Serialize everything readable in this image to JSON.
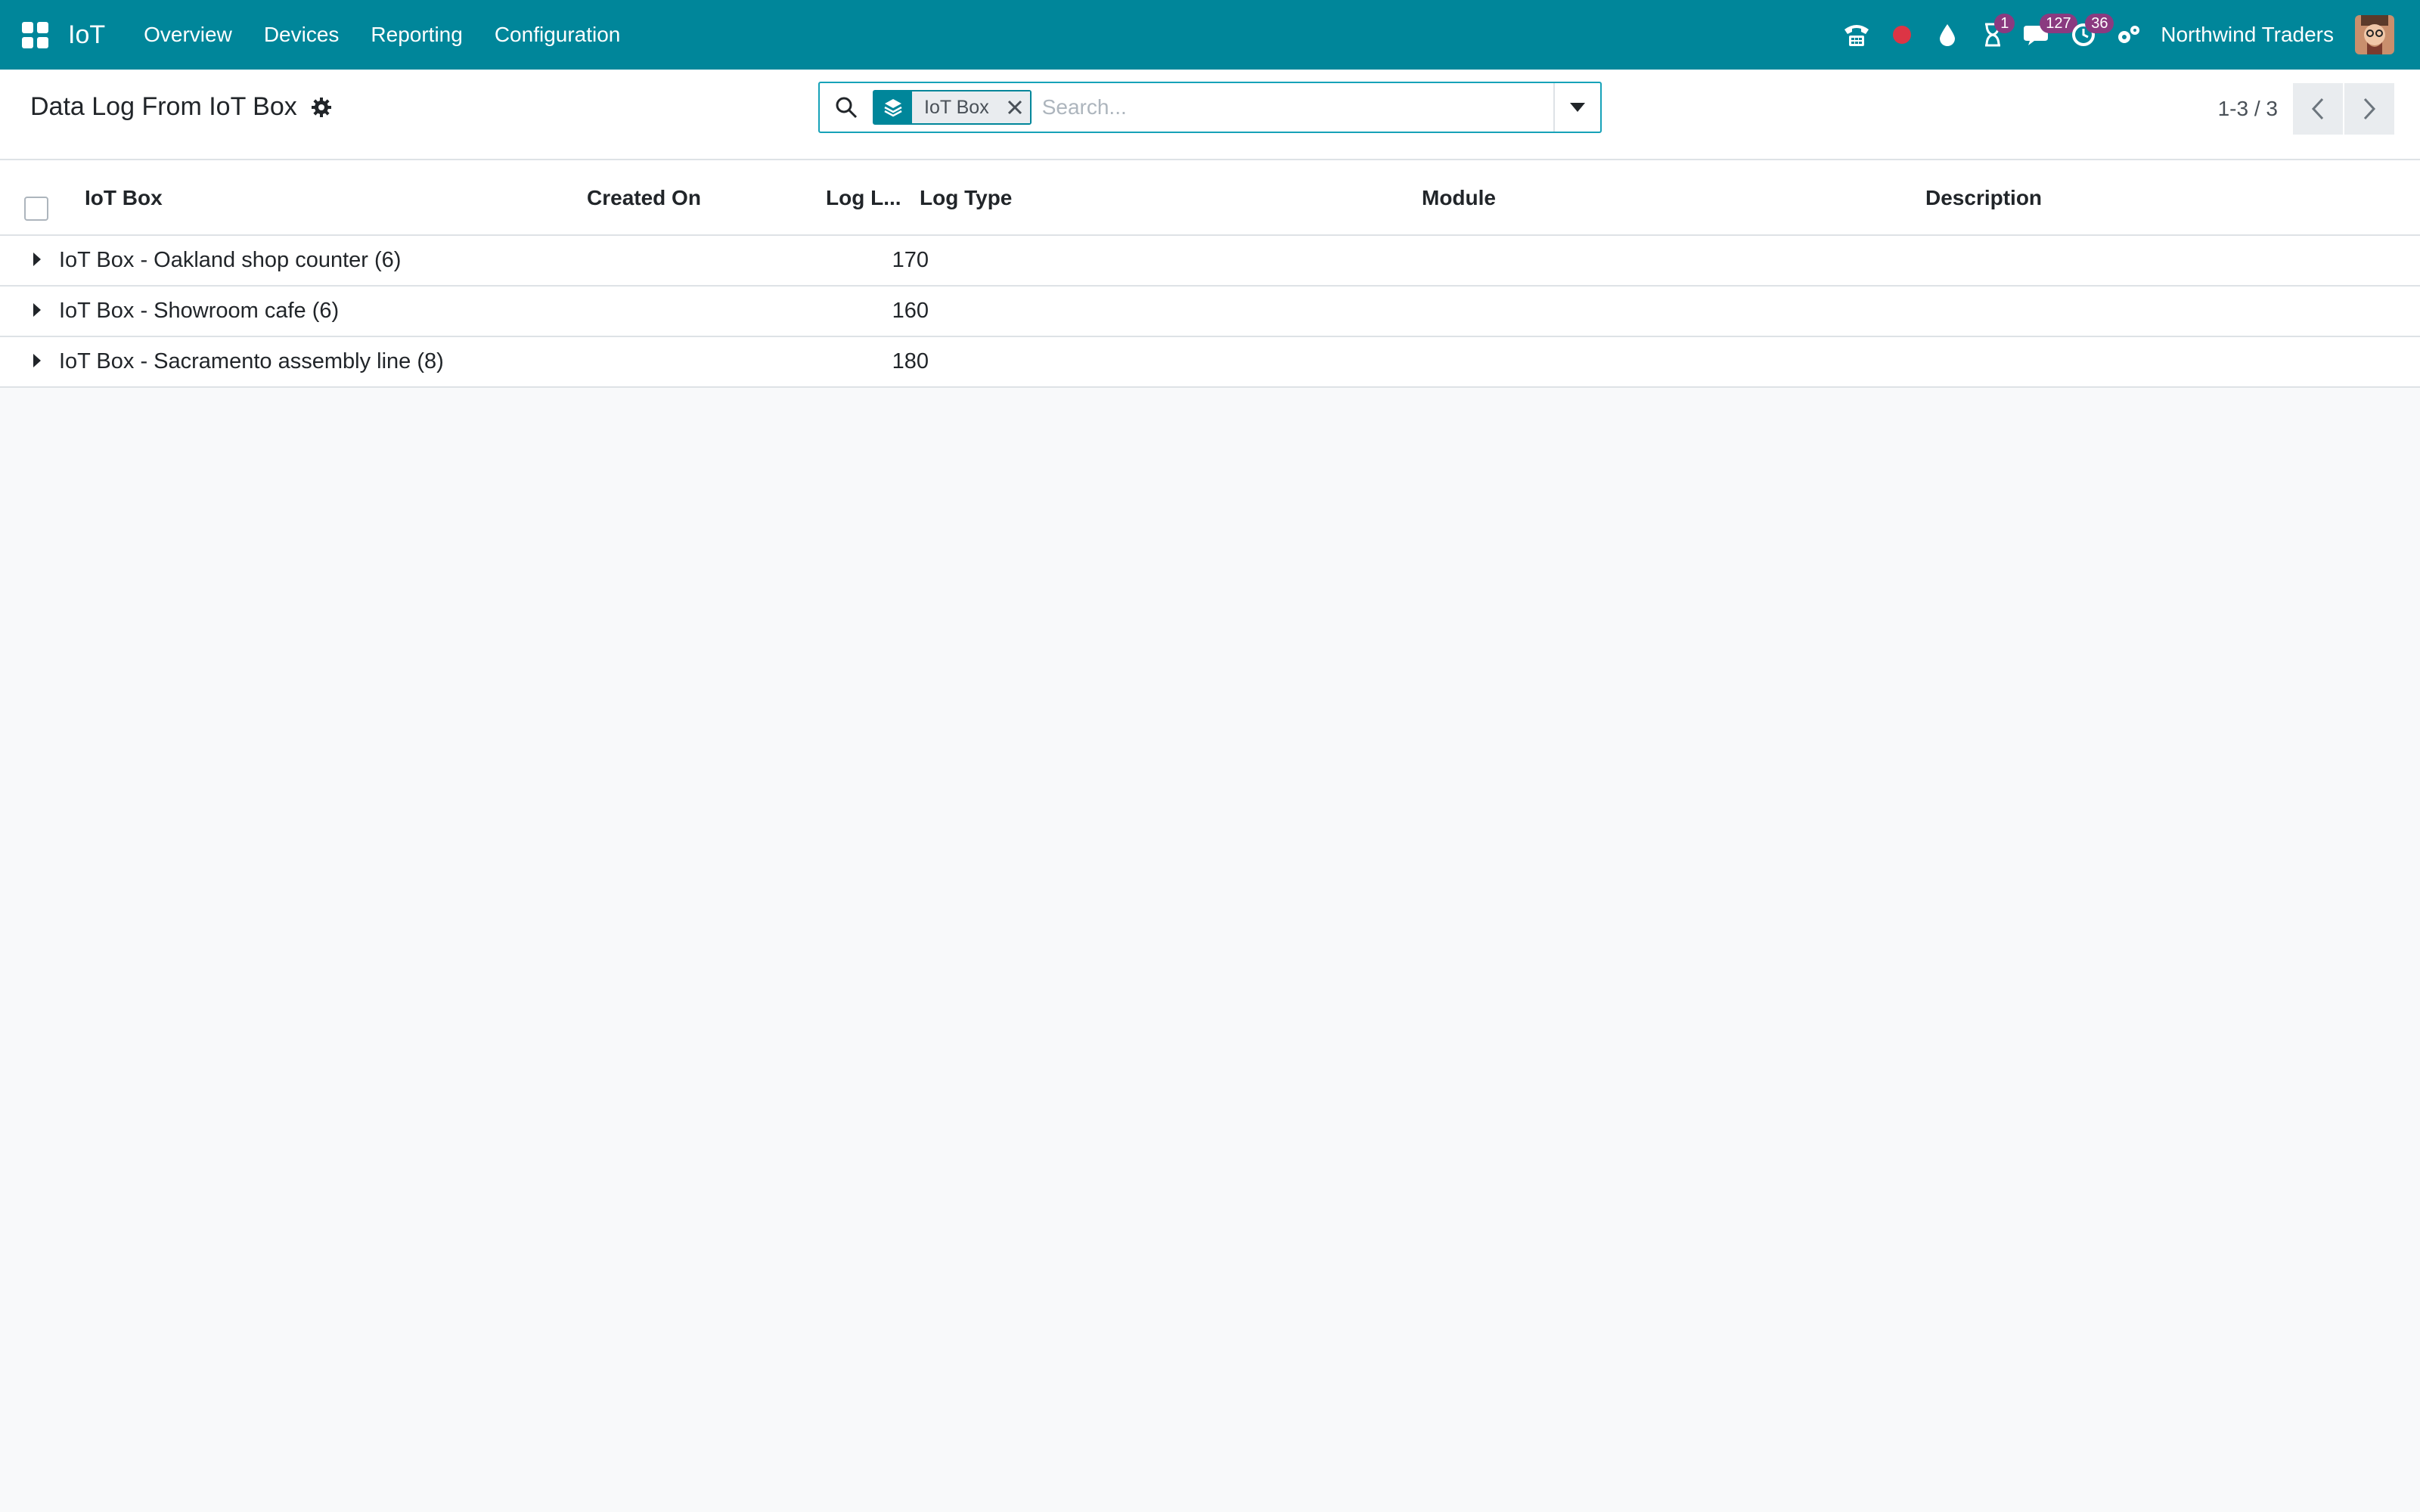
{
  "navbar": {
    "brand": "IoT",
    "menu": [
      "Overview",
      "Devices",
      "Reporting",
      "Configuration"
    ],
    "badges": {
      "activities": "1",
      "messages": "127",
      "timer": "36"
    },
    "company": "Northwind Traders",
    "color": "#00869a"
  },
  "control": {
    "title": "Data Log From IoT Box",
    "facet": "IoT Box",
    "search_placeholder": "Search...",
    "pager": "1-3 / 3"
  },
  "table": {
    "columns": [
      "IoT Box",
      "Created On",
      "Log L...",
      "Log Type",
      "Module",
      "Description"
    ],
    "groups": [
      {
        "label": "IoT Box - Oakland shop counter (6)",
        "value": "170"
      },
      {
        "label": "IoT Box - Showroom cafe (6)",
        "value": "160"
      },
      {
        "label": "IoT Box - Sacramento assembly line (8)",
        "value": "180"
      }
    ]
  }
}
